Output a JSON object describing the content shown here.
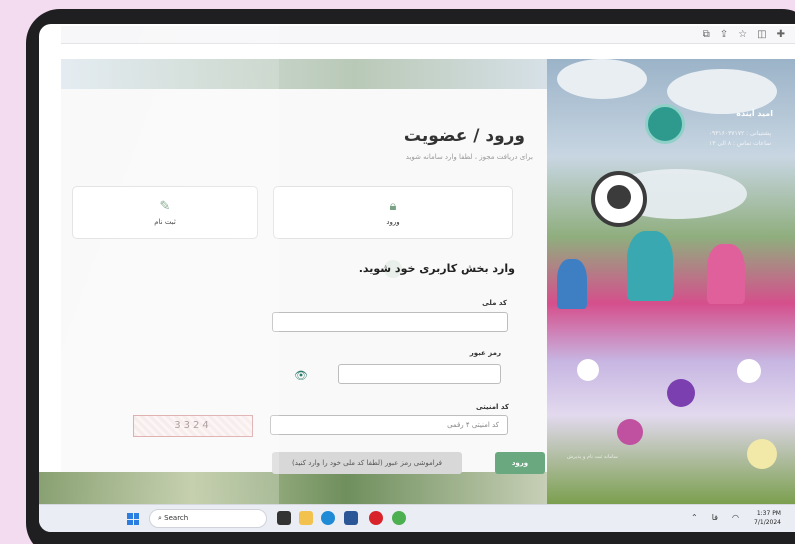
{
  "page": {
    "title": "ورود / عضویت",
    "subtitle": "برای دریافت مجوز ، لطفا وارد سامانه شوید"
  },
  "tabs": [
    {
      "label": "ورود",
      "icon": "lock-icon"
    },
    {
      "label": "ثبت نام",
      "icon": "pencil-icon"
    }
  ],
  "form": {
    "section_title": "وارد بخش کاربری خود شوید.",
    "national_code_label": "کد ملی",
    "national_code_value": "",
    "password_label": "رمز عبور",
    "password_value": "",
    "security_code_label": "کد امنیتی",
    "security_code_placeholder": "کد امنیتی ۴ رقمی",
    "captcha_text": "3324",
    "login_button": "ورود",
    "forgot_button": "فراموشی رمز عبور (لطفا کد ملی خود را وارد کنید)"
  },
  "hero": {
    "name": "امید آینده",
    "phone_line": "پشتیبانی : ۰۹۳۱۶۰۳۷۱۷۲",
    "hours_line": "ساعات تماس : ۸ الی ۱۳",
    "caption": "سامانه ثبت نام و پذیرش"
  },
  "taskbar": {
    "search_placeholder": "Search",
    "time": "1:37 PM",
    "date": "7/1/2024",
    "lang": "فا"
  },
  "colors": {
    "accent": "#6aa880",
    "page_bg": "#f3dcef",
    "device": "#1f1f22"
  }
}
